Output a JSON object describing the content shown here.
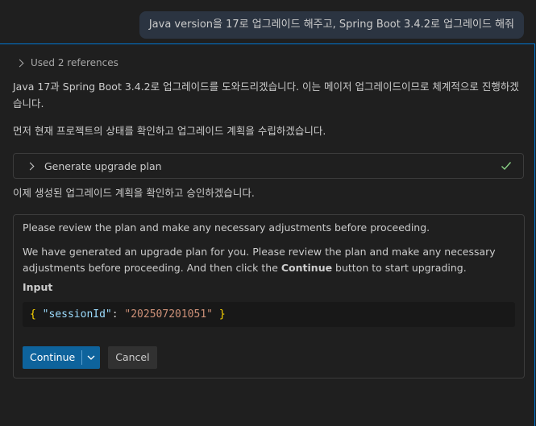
{
  "user_message": "Java version을 17로 업그레이드 해주고, Spring Boot 3.4.2로 업그레이드 해줘",
  "references": {
    "label": "Used 2 references"
  },
  "response": {
    "para1": "Java 17과 Spring Boot 3.4.2로 업그레이드를 도와드리겠습니다. 이는 메이저 업그레이드이므로 체계적으로 진행하겠습니다.",
    "para2": "먼저 현재 프로젝트의 상태를 확인하고 업그레이드 계획을 수립하겠습니다.",
    "tool_call": {
      "label": "Generate upgrade plan",
      "status_icon": "check-icon"
    },
    "para3": "이제 생성된 업그레이드 계획을 확인하고 승인하겠습니다."
  },
  "confirm_card": {
    "line1": "Please review the plan and make any necessary adjustments before proceeding.",
    "line2_before": "We have generated an upgrade plan for you. Please review the plan and make any necessary adjustments before proceeding. And then click the ",
    "line2_bold": "Continue",
    "line2_after": " button to start upgrading.",
    "input_label": "Input",
    "code": {
      "open": "{",
      "key": "\"sessionId\"",
      "colon": ": ",
      "value": "\"202507201051\"",
      "close": "}"
    },
    "continue_label": "Continue",
    "cancel_label": "Cancel"
  },
  "colors": {
    "accent": "#0078d4",
    "button_primary": "#0e639c",
    "check": "#89d185"
  }
}
